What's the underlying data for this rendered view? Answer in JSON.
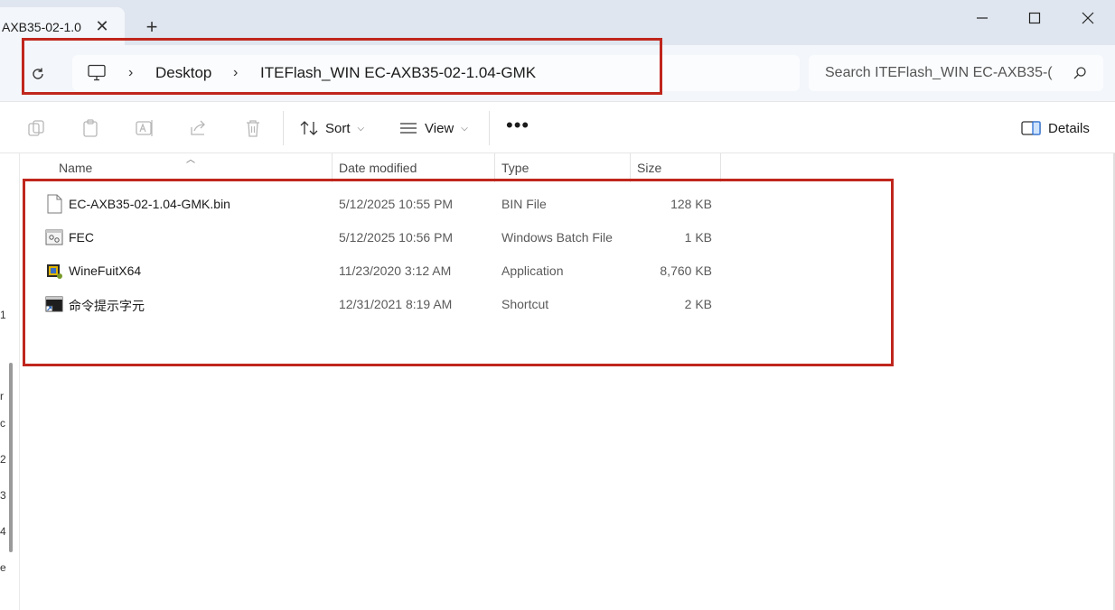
{
  "window": {
    "tab_title": "AXB35-02-1.0",
    "tab_close": "✕",
    "new_tab": "+",
    "minimize": "—",
    "close": "✕"
  },
  "address": {
    "crumbs": [
      "Desktop",
      "ITEFlash_WIN EC-AXB35-02-1.04-GMK"
    ],
    "separator": "›"
  },
  "search": {
    "placeholder": "Search ITEFlash_WIN EC-AXB35-("
  },
  "toolbar": {
    "sort_label": "Sort",
    "view_label": "View",
    "more_label": "•••",
    "details_label": "Details"
  },
  "columns": {
    "name": "Name",
    "date": "Date modified",
    "type": "Type",
    "size": "Size"
  },
  "files": [
    {
      "name": "EC-AXB35-02-1.04-GMK.bin",
      "date": "5/12/2025 10:55 PM",
      "type": "BIN File",
      "size": "128 KB",
      "icon": "generic-file-icon"
    },
    {
      "name": "FEC",
      "date": "5/12/2025 10:56 PM",
      "type": "Windows Batch File",
      "size": "1 KB",
      "icon": "batch-file-icon"
    },
    {
      "name": "WineFuitX64",
      "date": "11/23/2020 3:12 AM",
      "type": "Application",
      "size": "8,760 KB",
      "icon": "application-icon"
    },
    {
      "name": "命令提示字元",
      "date": "12/31/2021 8:19 AM",
      "type": "Shortcut",
      "size": "2 KB",
      "icon": "shortcut-icon"
    }
  ],
  "left_glyphs": [
    "1",
    "r",
    "c",
    "2",
    "3",
    "4",
    "e"
  ],
  "colors": {
    "highlight": "#c0261d",
    "titlebar": "#dfe6ef",
    "addressbar": "#f3f6fa"
  }
}
